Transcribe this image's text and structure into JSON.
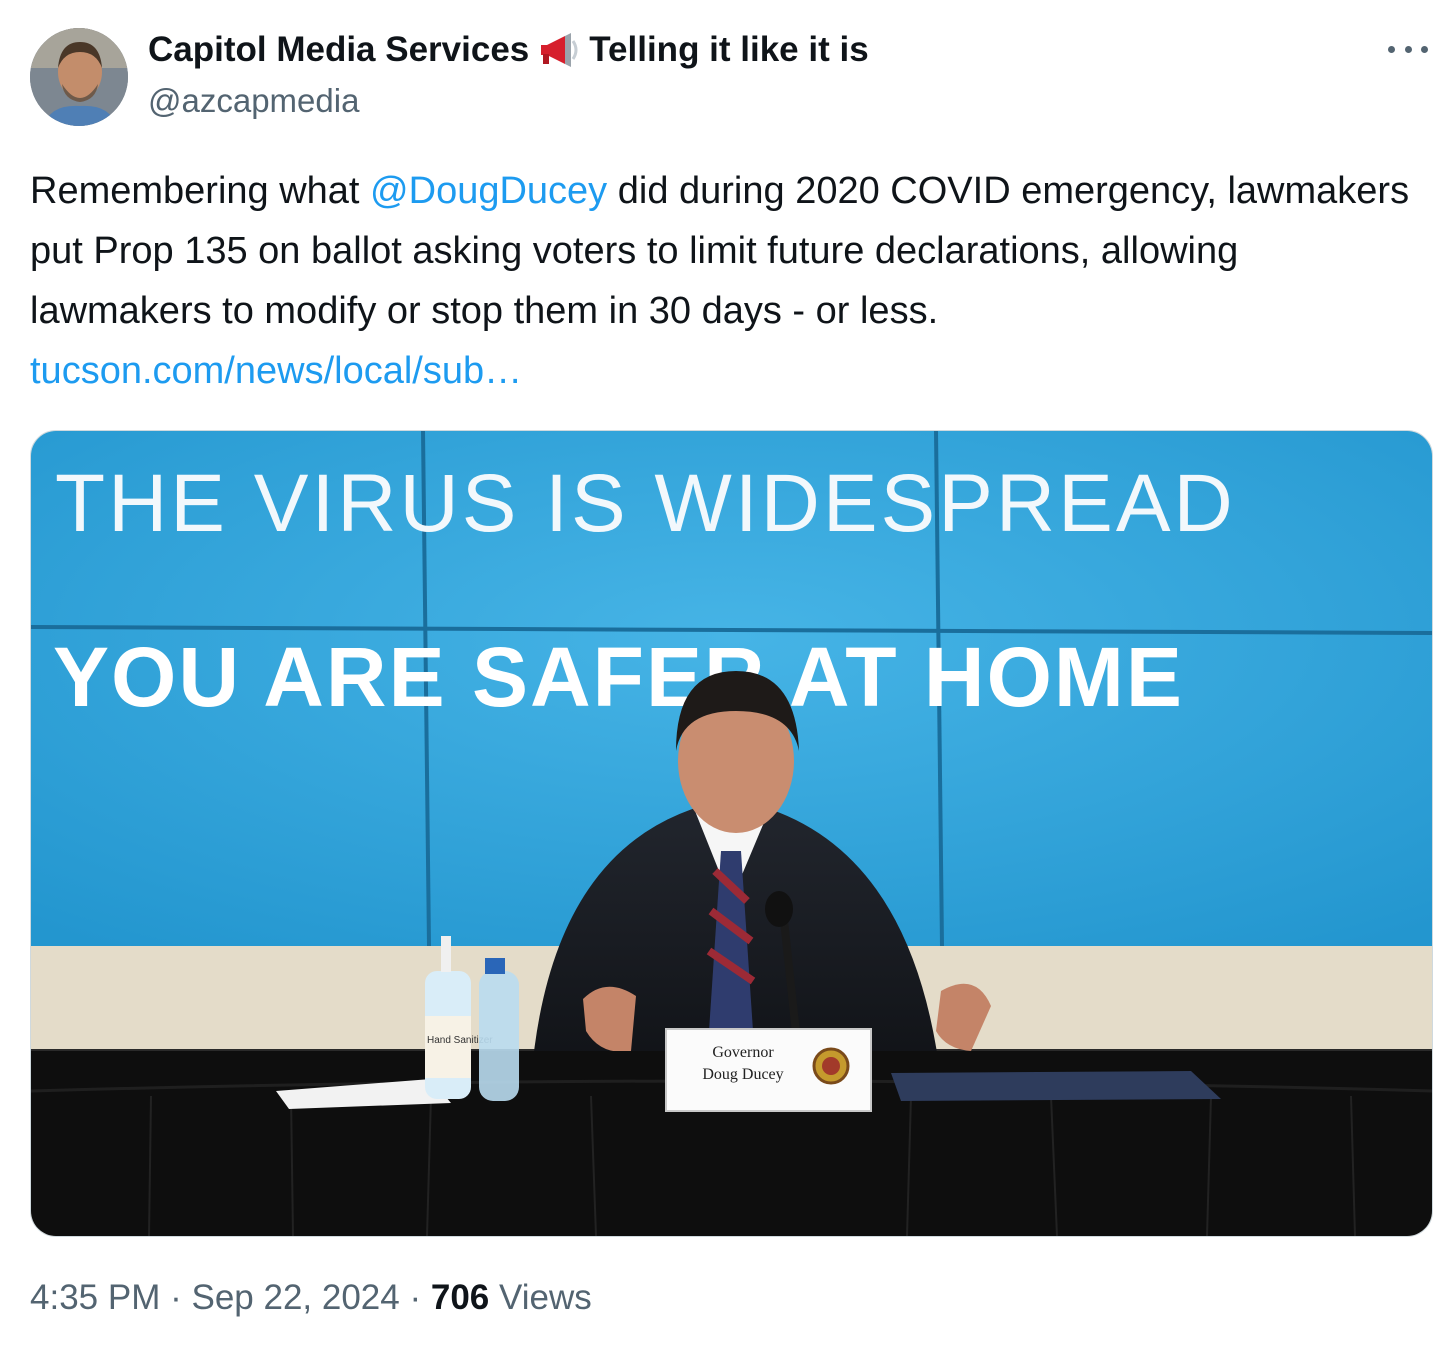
{
  "author": {
    "name": "Capitol Media Services",
    "tagline": "Telling it like it is",
    "handle": "@azcapmedia",
    "avatar_icon": "profile-photo"
  },
  "tweet": {
    "text_part1": "Remembering what ",
    "mention": "@DougDucey",
    "text_part2": " did during 2020 COVID emergency, lawmakers put Prop 135 on ballot asking voters to limit future declarations, allowing lawmakers to modify or stop them in 30 days - or less. ",
    "link": "tucson.com/news/local/sub…"
  },
  "media": {
    "screen_line1": "THE VIRUS IS WIDESPREAD",
    "screen_line2": "YOU ARE SAFER AT HOME",
    "nameplate_line1": "Governor",
    "nameplate_line2": "Doug Ducey",
    "sanitizer_label": "Hand Sanitizer",
    "screen_color": "#2fa5dc"
  },
  "footer": {
    "time": "4:35 PM",
    "date": "Sep 22, 2024",
    "views_count": "706",
    "views_label": "Views"
  },
  "colors": {
    "link": "#1d9bf0",
    "secondary_text": "#536471",
    "primary_text": "#0f1419"
  }
}
